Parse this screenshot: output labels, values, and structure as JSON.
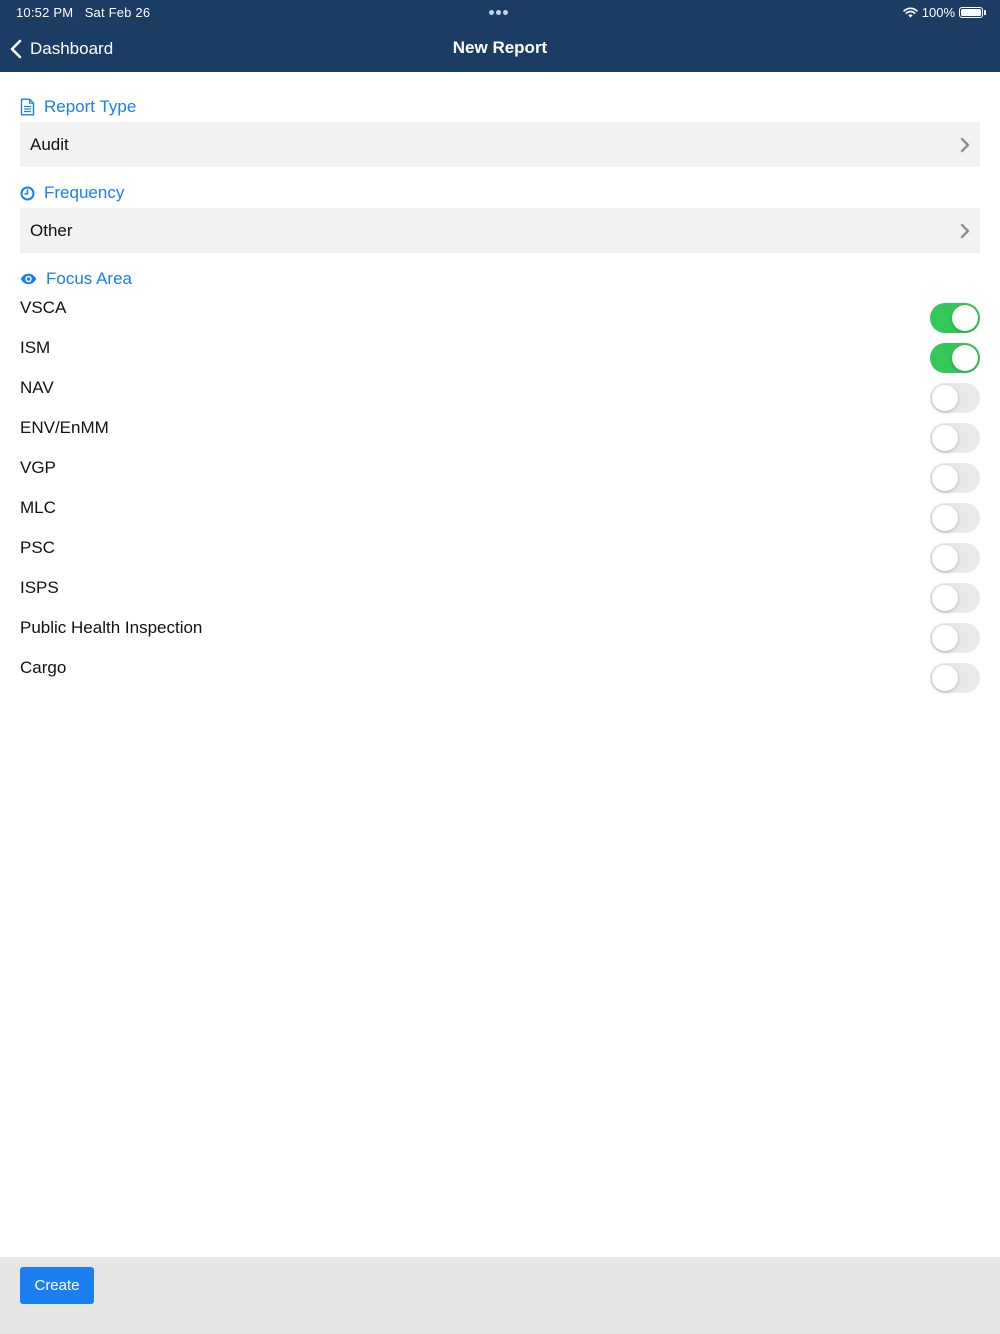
{
  "status_bar": {
    "time": "10:52 PM",
    "date": "Sat Feb 26",
    "battery": "100%"
  },
  "nav": {
    "back_label": "Dashboard",
    "title": "New Report"
  },
  "report_type": {
    "label": "Report Type",
    "value": "Audit"
  },
  "frequency": {
    "label": "Frequency",
    "value": "Other"
  },
  "focus_area": {
    "label": "Focus Area",
    "items": [
      {
        "label": "VSCA",
        "on": true
      },
      {
        "label": "ISM",
        "on": true
      },
      {
        "label": "NAV",
        "on": false
      },
      {
        "label": "ENV/EnMM",
        "on": false
      },
      {
        "label": "VGP",
        "on": false
      },
      {
        "label": "MLC",
        "on": false
      },
      {
        "label": "PSC",
        "on": false
      },
      {
        "label": "ISPS",
        "on": false
      },
      {
        "label": "Public Health Inspection",
        "on": false
      },
      {
        "label": "Cargo",
        "on": false
      }
    ]
  },
  "footer": {
    "create_label": "Create"
  },
  "colors": {
    "header_bg": "#1c3d63",
    "accent": "#1a7ff0",
    "toggle_on": "#34c759",
    "toggle_off": "#e9e9ea"
  }
}
